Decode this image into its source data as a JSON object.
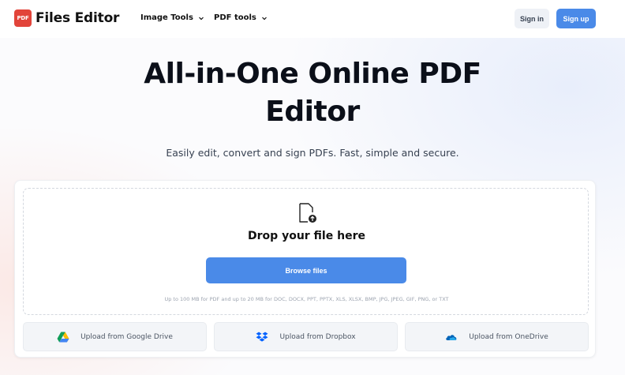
{
  "header": {
    "logo_badge": "PDF",
    "logo_text": "Files Editor",
    "nav": [
      {
        "label": "Image Tools"
      },
      {
        "label": "PDF tools"
      }
    ],
    "signin_label": "Sign in",
    "signup_label": "Sign up"
  },
  "hero": {
    "title_line1": "All-in-One Online PDF",
    "title_line2": "Editor",
    "subtitle": "Easily edit, convert and sign PDFs. Fast, simple and secure."
  },
  "upload": {
    "drop_text": "Drop your file here",
    "browse_label": "Browse files",
    "limits_text": "Up to 100 MB for PDF and up to 20 MB for DOC, DOCX, PPT, PPTX, XLS, XLSX, BMP, JPG, JPEG, GIF, PNG, or TXT",
    "sources": [
      {
        "label": "Upload from Google Drive",
        "icon": "google-drive-icon"
      },
      {
        "label": "Upload from Dropbox",
        "icon": "dropbox-icon"
      },
      {
        "label": "Upload from OneDrive",
        "icon": "onedrive-icon"
      }
    ]
  },
  "colors": {
    "accent": "#4a8ae8",
    "brand": "#e2443a",
    "title_text": "#0b0f19"
  }
}
